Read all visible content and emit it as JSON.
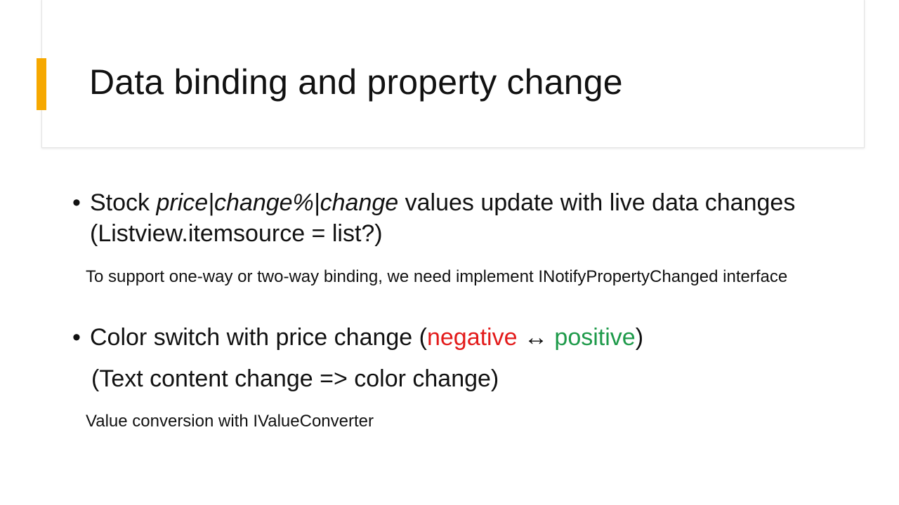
{
  "slide": {
    "title": "Data binding and property change",
    "bullet1": {
      "prefix": "Stock ",
      "emph": "price|change%|change",
      "rest": "  values update with live data changes (Listview.itemsource = list?)"
    },
    "note1": "To support one-way or two-way binding, we need implement INotifyPropertyChanged interface",
    "bullet2": {
      "prefix": "Color switch with price change (",
      "negative": "negative",
      "arrow": " ↔ ",
      "positive": "positive",
      "suffix": ")"
    },
    "line3": "(Text content change => color change)",
    "note2": "Value conversion with IValueConverter",
    "bullet_char": "•"
  },
  "colors": {
    "accent": "#f6a800",
    "negative": "#e31b1b",
    "positive": "#1e9a4a"
  }
}
